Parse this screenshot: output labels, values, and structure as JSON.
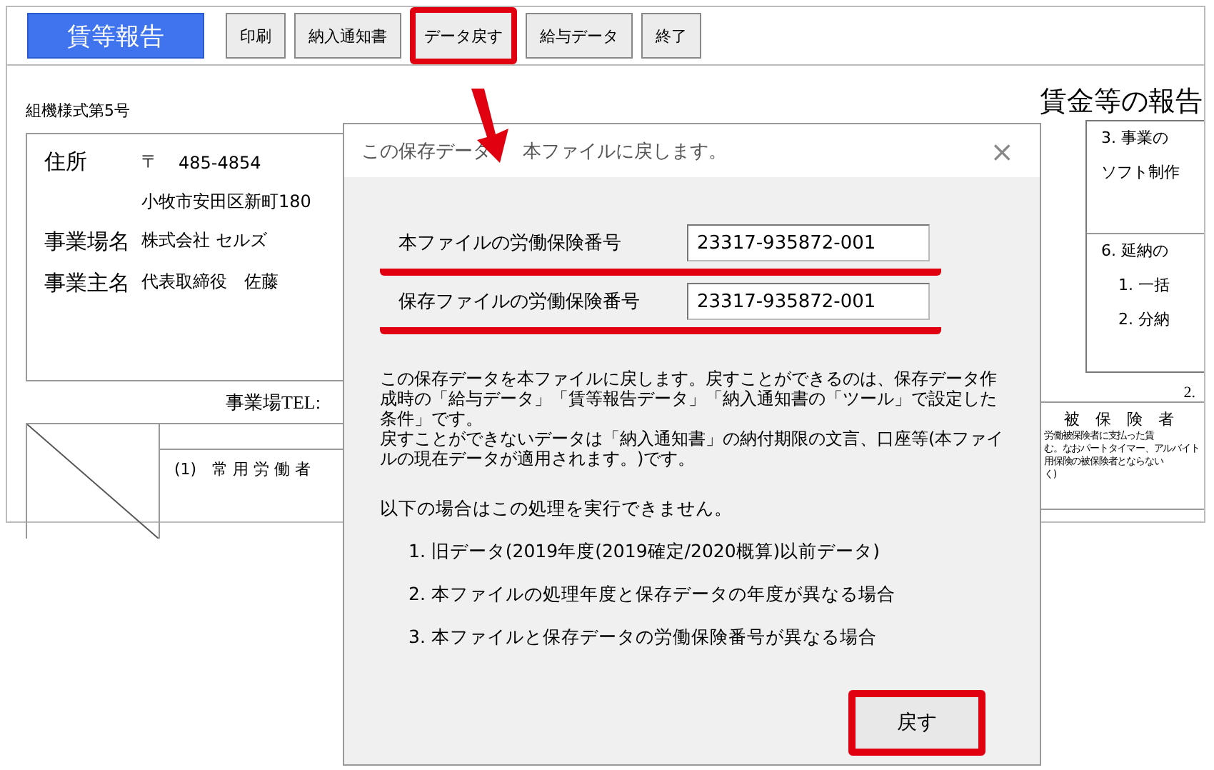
{
  "toolbar": {
    "title_button": "賃等報告",
    "buttons": [
      {
        "label": "印刷",
        "highlighted": false
      },
      {
        "label": "納入通知書",
        "highlighted": false
      },
      {
        "label": "データ戻す",
        "highlighted": true
      },
      {
        "label": "給与データ",
        "highlighted": false
      },
      {
        "label": "終了",
        "highlighted": false
      }
    ]
  },
  "document": {
    "form_number": "組機様式第5号",
    "title": "賃金等の報告",
    "address": {
      "label": "住所",
      "postal_mark": "〒",
      "postal_code": "485-4854",
      "street": "小牧市安田区新町180"
    },
    "business_name": {
      "label": "事業場名",
      "value": "株式会社 セルズ"
    },
    "owner": {
      "label": "事業主名",
      "value": "代表取締役　佐藤"
    },
    "tel_label": "事業場TEL:",
    "table_row": "(1)　常 用 労 働 者",
    "business_box": {
      "heading": "3. 事業の",
      "value": "ソフト制作"
    },
    "deferral_box": {
      "heading": "6. 延納の",
      "options": [
        "1. 一括",
        "2. 分納"
      ]
    },
    "section_number": "2.",
    "insured_cell": {
      "heading": "被　保　険　者",
      "lines": [
        "労働被保険者に支払った賃",
        "む。なおパートタイマー、アルバイト",
        "用保険の被保険者とならない",
        "く)"
      ]
    }
  },
  "dialog": {
    "title": [
      "この保存データ",
      "本ファイルに戻します。"
    ],
    "close": "×",
    "fields": [
      {
        "label": "本ファイルの労働保険番号",
        "value": "23317-935872-001",
        "underlined": true
      },
      {
        "label": "保存ファイルの労働保険番号",
        "value": "23317-935872-001",
        "underlined": true
      }
    ],
    "paragraphs": [
      "この保存データを本ファイルに戻します。戻すことができるのは、保存データ作成時の「給与データ」「賃等報告データ」「納入通知書の「ツール」で設定した条件」です。",
      "戻すことができないデータは「納入通知書」の納付期限の文言、口座等(本ファイルの現在データが適用されます。)です。"
    ],
    "conditions_intro": "以下の場合はこの処理を実行できません。",
    "conditions": [
      "1. 旧データ(2019年度(2019確定/2020概算)以前データ)",
      "2. 本ファイルの処理年度と保存データの年度が異なる場合",
      "3. 本ファイルと保存データの労働保険番号が異なる場合"
    ],
    "button": {
      "label": "戻す",
      "highlighted": true
    }
  }
}
